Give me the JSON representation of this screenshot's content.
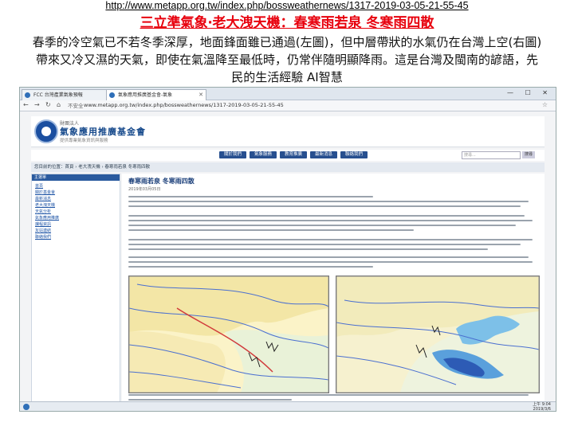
{
  "slide": {
    "url_text": "http://www.metapp.org.tw/index.php/bossweathernews/1317-2019-03-05-21-55-45",
    "title": "三立準氣象‧老大洩天機：春寒雨若泉 冬寒雨四散",
    "body": "春季的冷空氣已不若冬季深厚，地面鋒面雖已通過(左圖)，但中層帶狀的水氣仍在台灣上空(右圖)帶來又冷又濕的天氣，即使在氣溫降至最低時，仍常伴隨明顯降雨。這是台灣及閩南的諺語，先民的生活經驗 AI智慧"
  },
  "browser": {
    "tabs": [
      {
        "label": "FCC 台灣產業氣象預報"
      },
      {
        "label": "氣象應用推廣基金會-氣象"
      }
    ],
    "window_controls": "— ☐ ✕",
    "nav": {
      "back": "←",
      "forward": "→",
      "refresh": "↻",
      "home": "⌂"
    },
    "lock_label": "不安全",
    "address": "www.metapp.org.tw/index.php/bossweathernews/1317-2019-03-05-21-55-45",
    "bookmark_icon": "☆"
  },
  "site": {
    "org_small": "財團法人",
    "org_name": "氣象應用推廣基金會",
    "tagline": "提供專業氣象資訊與服務",
    "menu": [
      "關於我們",
      "氣象服務",
      "教育推廣",
      "最新消息",
      "聯絡我們"
    ],
    "search_placeholder": "搜尋...",
    "search_button": "搜尋",
    "breadcrumb": "您目前的位置：首頁 › 老大洩天機 › 春寒雨若泉 冬寒雨四散"
  },
  "sidebar": {
    "heading": "主選單",
    "items": [
      "首頁",
      "關於基金會",
      "最新消息",
      "老大洩天機",
      "天氣分析",
      "氣象應用推廣",
      "課程資訊",
      "友站連結",
      "聯絡我們"
    ]
  },
  "article": {
    "title": "春寒雨若泉 冬寒雨四散",
    "date": "2019年03月05日"
  },
  "taskbar": {
    "time": "上午 9:04",
    "date": "2019/3/6"
  },
  "colors": {
    "title_red": "#e8000d",
    "nav_blue": "#274f8f",
    "link_blue": "#1f55a6"
  }
}
